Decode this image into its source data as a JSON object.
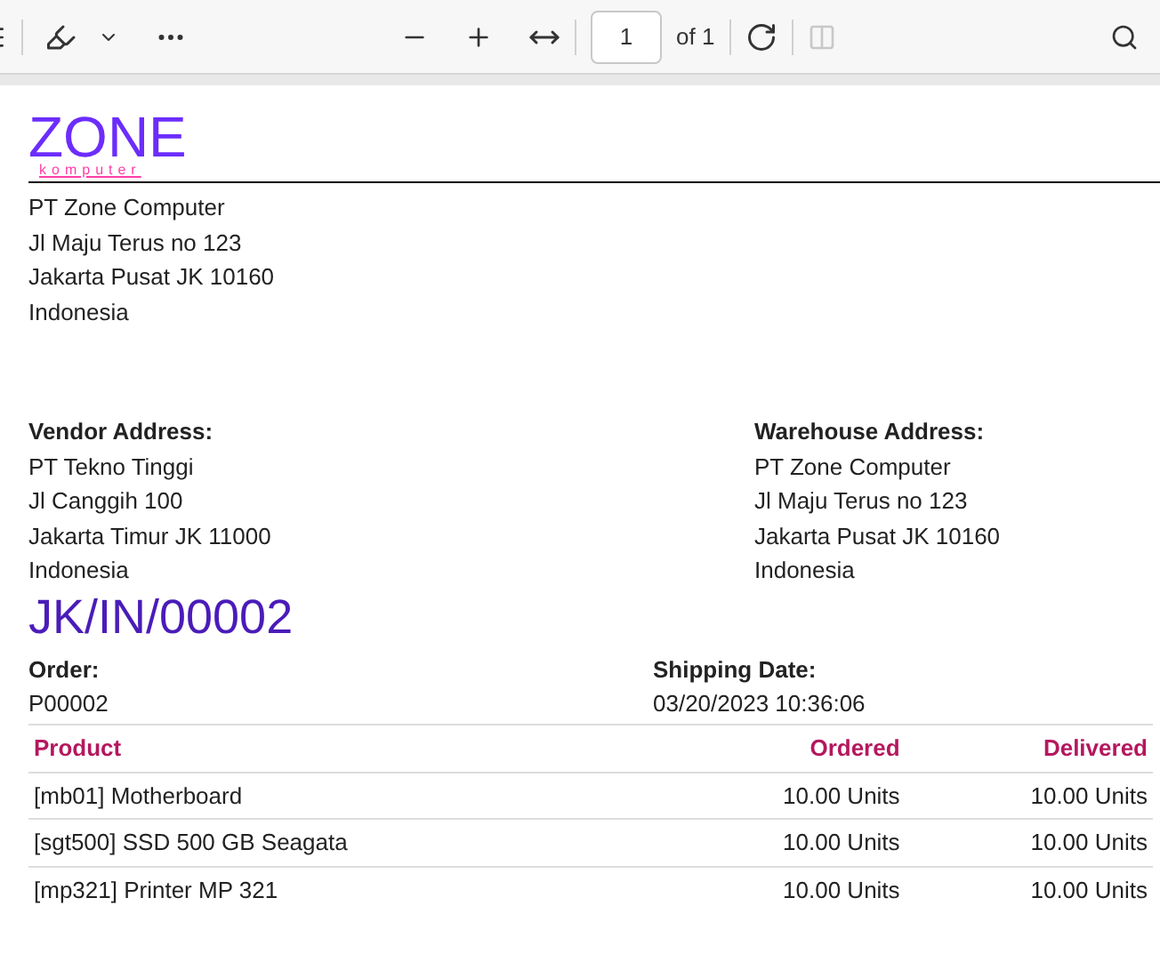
{
  "toolbar": {
    "page_number": "1",
    "page_count": "of 1"
  },
  "document": {
    "logo": {
      "name": "ZONE",
      "tagline": "komputer"
    },
    "company_address": [
      "PT Zone Computer",
      "Jl Maju Terus no 123",
      "Jakarta Pusat JK 10160",
      "Indonesia"
    ],
    "vendor": {
      "heading": "Vendor Address:",
      "lines": [
        "PT Tekno Tinggi",
        "Jl Canggih 100",
        "Jakarta Timur JK 11000",
        "Indonesia"
      ]
    },
    "warehouse": {
      "heading": "Warehouse Address:",
      "lines": [
        "PT Zone Computer",
        "Jl Maju Terus no 123",
        "Jakarta Pusat JK 10160",
        "Indonesia"
      ]
    },
    "reference": "JK/IN/00002",
    "order": {
      "label": "Order:",
      "value": "P00002"
    },
    "shipping_date": {
      "label": "Shipping Date:",
      "value": "03/20/2023 10:36:06"
    },
    "table": {
      "columns": [
        "Product",
        "Ordered",
        "Delivered"
      ],
      "rows": [
        [
          "[mb01] Motherboard",
          "10.00 Units",
          "10.00 Units"
        ],
        [
          "[sgt500] SSD 500 GB Seagata",
          "10.00 Units",
          "10.00 Units"
        ],
        [
          "[mp321] Printer MP 321",
          "10.00 Units",
          "10.00 Units"
        ]
      ]
    }
  }
}
